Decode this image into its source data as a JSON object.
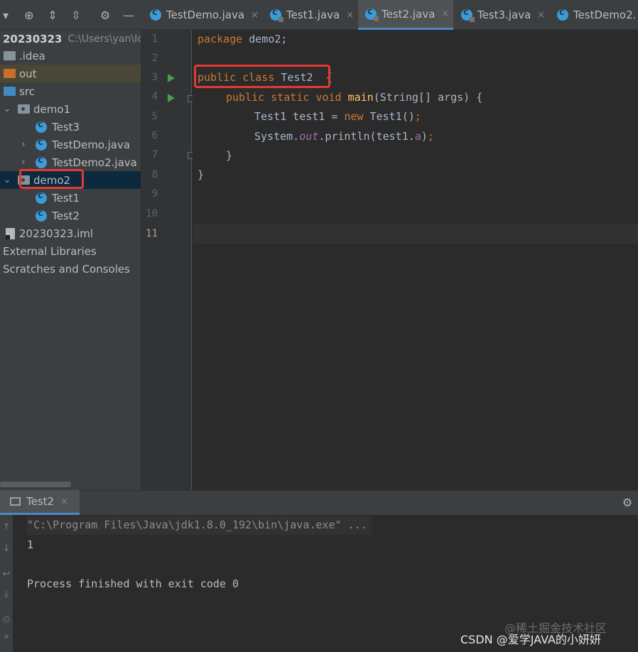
{
  "toolbar": {
    "icons": [
      "dropdown-icon",
      "crosshair-icon",
      "expand-all-icon",
      "collapse-all-icon",
      "gear-icon",
      "minimize-icon"
    ]
  },
  "tabs": [
    {
      "label": "TestDemo.java",
      "active": false
    },
    {
      "label": "Test1.java",
      "active": false
    },
    {
      "label": "Test2.java",
      "active": true
    },
    {
      "label": "Test3.java",
      "active": false
    },
    {
      "label": "TestDemo2.",
      "active": false
    }
  ],
  "tree": {
    "root_name": "20230323",
    "root_path": "C:\\Users\\yan\\Ide",
    "idea": ".idea",
    "out": "out",
    "src": "src",
    "demo1": "demo1",
    "test3": "Test3",
    "testdemo": "TestDemo.java",
    "testdemo2": "TestDemo2.java",
    "demo2": "demo2",
    "test1": "Test1",
    "test2": "Test2",
    "iml": "20230323.iml",
    "libs": "External Libraries",
    "scratches": "Scratches and Consoles"
  },
  "gutter": {
    "lines": [
      "1",
      "2",
      "3",
      "4",
      "5",
      "6",
      "7",
      "8",
      "9",
      "10",
      "11"
    ]
  },
  "code": {
    "l1_kw": "package",
    "l1_rest": " demo2;",
    "l3_kw1": "public",
    "l3_kw2": "class",
    "l3_name": "Test2",
    "l3_brace": "  {",
    "l4_kw1": "public",
    "l4_kw2": "static",
    "l4_kw3": "void",
    "l4_fn": "main",
    "l4_rest": "(String[] args) {",
    "l5_a": "Test1 test1 = ",
    "l5_new": "new",
    "l5_b": " Test1()",
    "l5_semi": ";",
    "l6_a": "System.",
    "l6_out": "out",
    "l6_b": ".println(test1.",
    "l6_fld": "a",
    "l6_c": ")",
    "l6_semi": ";",
    "l7": "}",
    "l8": "}"
  },
  "run_panel": {
    "tab_label": "Test2",
    "command": "\"C:\\Program Files\\Java\\jdk1.8.0_192\\bin\\java.exe\" ...",
    "output": "1",
    "exit_message": "Process finished with exit code 0"
  },
  "watermark": {
    "juejin": "@稀土掘金技术社区",
    "csdn": "CSDN @爱学JAVA的小妍妍"
  },
  "colors": {
    "accent": "#4a88c7",
    "highlight": "#e53935",
    "keyword": "#cc7832",
    "method": "#ffc66d",
    "field": "#9876aa"
  }
}
